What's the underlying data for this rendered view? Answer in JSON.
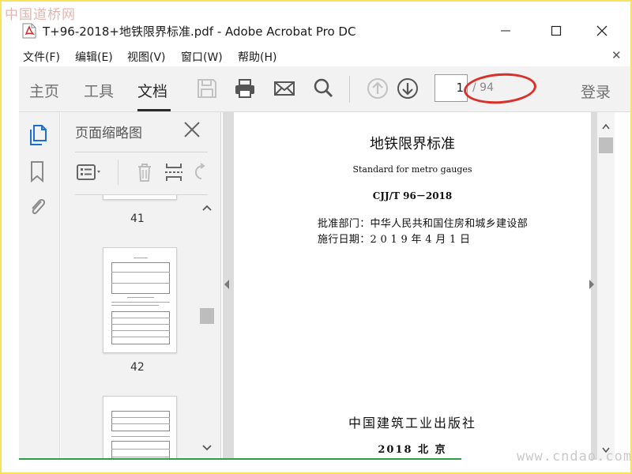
{
  "watermark_top": "中国道桥网",
  "watermark_bottom": "www.cndao.com",
  "window": {
    "title": "T+96-2018+地铁限界标准.pdf - Adobe Acrobat Pro DC"
  },
  "menu": {
    "items": [
      "文件(F)",
      "编辑(E)",
      "视图(V)",
      "窗口(W)",
      "帮助(H)"
    ]
  },
  "toolbar": {
    "tabs": [
      "主页",
      "工具",
      "文档"
    ],
    "active_tab": "文档",
    "page_current": "1",
    "page_total": "/ 94",
    "signin": "登录",
    "icons": [
      "save-icon",
      "print-icon",
      "email-icon",
      "search-icon",
      "page-up-icon",
      "page-down-icon"
    ]
  },
  "left_rail": {
    "icons": [
      "page-thumbnails-icon",
      "bookmark-icon",
      "attachment-icon"
    ]
  },
  "thumb_panel": {
    "title": "页面缩略图",
    "pages": [
      "41",
      "42"
    ]
  },
  "document": {
    "title": "地铁限界标准",
    "subtitle": "Standard for metro gauges",
    "code": "CJJ/T 96－2018",
    "approval_dept": "批准部门：中华人民共和国住房和城乡建设部",
    "effective_date": "施行日期：2 0 1 9 年 4 月 1 日",
    "publisher": "中国建筑工业出版社",
    "publish_info": "2018 北 京"
  },
  "colors": {
    "accent_red": "#d9302a",
    "bottom_line": "#2e9e4a",
    "frame_border": "#f7e35c"
  }
}
